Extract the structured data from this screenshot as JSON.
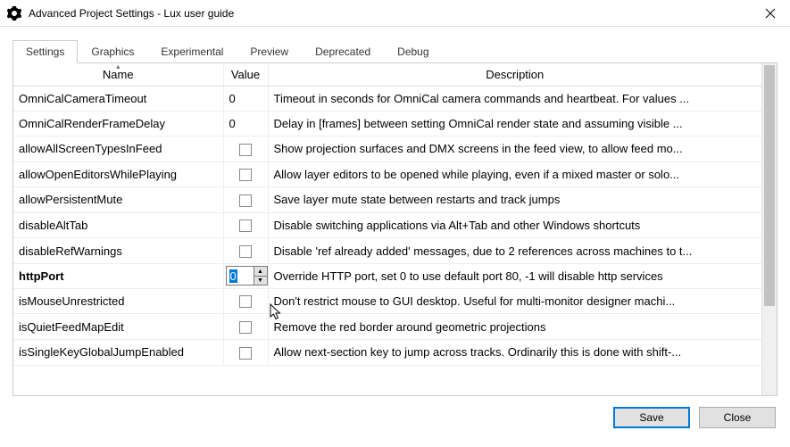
{
  "window": {
    "title": "Advanced Project Settings - Lux user guide"
  },
  "tabs": [
    {
      "label": "Settings",
      "active": true
    },
    {
      "label": "Graphics",
      "active": false
    },
    {
      "label": "Experimental",
      "active": false
    },
    {
      "label": "Preview",
      "active": false
    },
    {
      "label": "Deprecated",
      "active": false
    },
    {
      "label": "Debug",
      "active": false
    }
  ],
  "columns": {
    "name": "Name",
    "value": "Value",
    "description": "Description"
  },
  "rows": [
    {
      "name": "OmniCalCameraTimeout",
      "type": "text",
      "value": "0",
      "description": "Timeout in seconds for OmniCal camera commands and heartbeat. For values ..."
    },
    {
      "name": "OmniCalRenderFrameDelay",
      "type": "text",
      "value": "0",
      "description": "Delay in [frames] between setting OmniCal render state and assuming visible ..."
    },
    {
      "name": "allowAllScreenTypesInFeed",
      "type": "check",
      "value": false,
      "description": "Show projection surfaces and DMX screens in the feed view, to allow feed mo..."
    },
    {
      "name": "allowOpenEditorsWhilePlaying",
      "type": "check",
      "value": false,
      "description": "Allow layer editors to be opened while playing, even if a mixed master or solo..."
    },
    {
      "name": "allowPersistentMute",
      "type": "check",
      "value": false,
      "description": "Save layer mute state between restarts and track jumps"
    },
    {
      "name": "disableAltTab",
      "type": "check",
      "value": false,
      "description": "Disable switching applications via Alt+Tab and other Windows shortcuts"
    },
    {
      "name": "disableRefWarnings",
      "type": "check",
      "value": false,
      "description": "Disable 'ref already added' messages, due to 2 references across machines to t..."
    },
    {
      "name": "httpPort",
      "type": "spinner",
      "value": "0",
      "bold": true,
      "description": "Override HTTP port, set 0 to use default port 80, -1 will disable http services"
    },
    {
      "name": "isMouseUnrestricted",
      "type": "check",
      "value": false,
      "description": "Don't restrict mouse to GUI desktop. Useful for multi-monitor designer machi..."
    },
    {
      "name": "isQuietFeedMapEdit",
      "type": "check",
      "value": false,
      "description": "Remove the red border around geometric projections"
    },
    {
      "name": "isSingleKeyGlobalJumpEnabled",
      "type": "check",
      "value": false,
      "description": "Allow next-section key to jump across tracks. Ordinarily this is done with shift-..."
    }
  ],
  "footer": {
    "save": "Save",
    "close": "Close"
  }
}
